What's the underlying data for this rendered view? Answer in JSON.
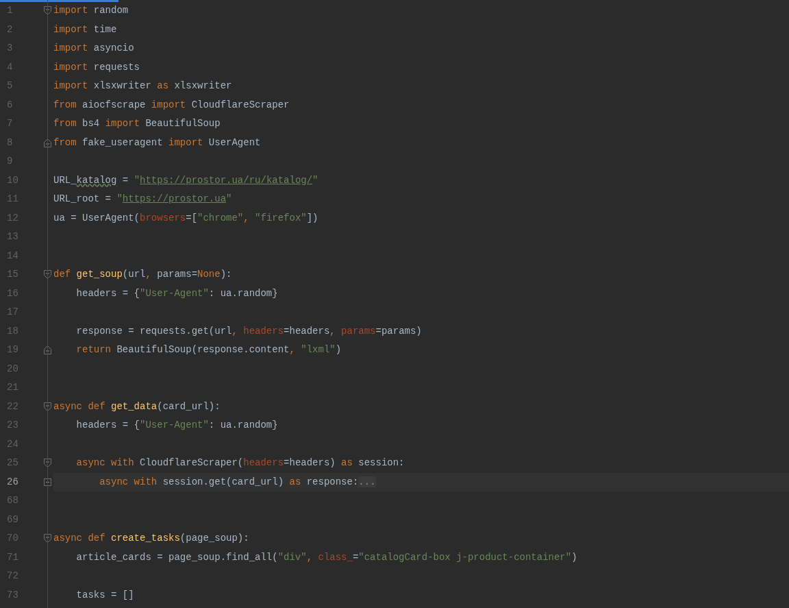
{
  "editor": {
    "lines": [
      {
        "number": "1",
        "fold": {
          "kind": "open"
        },
        "current": false,
        "tokens": [
          {
            "kind": "kw",
            "text": "import "
          },
          {
            "kind": "plain",
            "text": "random"
          }
        ]
      },
      {
        "number": "2",
        "current": false,
        "tokens": [
          {
            "kind": "kw",
            "text": "import "
          },
          {
            "kind": "plain",
            "text": "time"
          }
        ]
      },
      {
        "number": "3",
        "current": false,
        "tokens": [
          {
            "kind": "kw",
            "text": "import "
          },
          {
            "kind": "plain",
            "text": "asyncio"
          }
        ]
      },
      {
        "number": "4",
        "current": false,
        "tokens": [
          {
            "kind": "kw",
            "text": "import "
          },
          {
            "kind": "plain",
            "text": "requests"
          }
        ]
      },
      {
        "number": "5",
        "current": false,
        "tokens": [
          {
            "kind": "kw",
            "text": "import "
          },
          {
            "kind": "plain",
            "text": "xlsxwriter "
          },
          {
            "kind": "kw",
            "text": "as "
          },
          {
            "kind": "plain",
            "text": "xlsxwriter"
          }
        ]
      },
      {
        "number": "6",
        "current": false,
        "tokens": [
          {
            "kind": "kw",
            "text": "from "
          },
          {
            "kind": "plain",
            "text": "aiocfscrape "
          },
          {
            "kind": "kw",
            "text": "import "
          },
          {
            "kind": "plain",
            "text": "CloudflareScraper"
          }
        ]
      },
      {
        "number": "7",
        "current": false,
        "tokens": [
          {
            "kind": "kw",
            "text": "from "
          },
          {
            "kind": "plain",
            "text": "bs4 "
          },
          {
            "kind": "kw",
            "text": "import "
          },
          {
            "kind": "plain",
            "text": "BeautifulSoup"
          }
        ]
      },
      {
        "number": "8",
        "fold": {
          "kind": "close"
        },
        "current": false,
        "tokens": [
          {
            "kind": "kw",
            "text": "from "
          },
          {
            "kind": "plain",
            "text": "fake_useragent "
          },
          {
            "kind": "kw",
            "text": "import "
          },
          {
            "kind": "plain",
            "text": "UserAgent"
          }
        ]
      },
      {
        "number": "9",
        "current": false
      },
      {
        "number": "10",
        "current": false,
        "tokens": [
          {
            "kind": "plain",
            "text": "URL_"
          },
          {
            "kind": "typo",
            "text": "katalog"
          },
          {
            "kind": "plain",
            "text": " = "
          },
          {
            "kind": "str",
            "text": "\""
          },
          {
            "kind": "link",
            "text": "https://prostor.ua/ru/katalog/"
          },
          {
            "kind": "str",
            "text": "\""
          }
        ]
      },
      {
        "number": "11",
        "current": false,
        "tokens": [
          {
            "kind": "plain",
            "text": "URL_root = "
          },
          {
            "kind": "str",
            "text": "\""
          },
          {
            "kind": "link",
            "text": "https://prostor.ua"
          },
          {
            "kind": "str",
            "text": "\""
          }
        ]
      },
      {
        "number": "12",
        "current": false,
        "tokens": [
          {
            "kind": "plain",
            "text": "ua = UserAgent("
          },
          {
            "kind": "param",
            "text": "browsers"
          },
          {
            "kind": "plain",
            "text": "=["
          },
          {
            "kind": "str",
            "text": "\"chrome\""
          },
          {
            "kind": "kw",
            "text": ", "
          },
          {
            "kind": "str",
            "text": "\"firefox\""
          },
          {
            "kind": "plain",
            "text": "])"
          }
        ]
      },
      {
        "number": "13",
        "current": false
      },
      {
        "number": "14",
        "current": false
      },
      {
        "number": "15",
        "fold": {
          "kind": "open"
        },
        "current": false,
        "tokens": [
          {
            "kind": "kw",
            "text": "def "
          },
          {
            "kind": "fn",
            "text": "get_soup"
          },
          {
            "kind": "plain",
            "text": "(url"
          },
          {
            "kind": "kw",
            "text": ", "
          },
          {
            "kind": "plain",
            "text": "params="
          },
          {
            "kind": "kw",
            "text": "None"
          },
          {
            "kind": "plain",
            "text": "):"
          }
        ]
      },
      {
        "number": "16",
        "current": false,
        "tokens": [
          {
            "kind": "plain",
            "text": "    headers = {"
          },
          {
            "kind": "str",
            "text": "\"User-Agent\""
          },
          {
            "kind": "plain",
            "text": ": ua.random}"
          }
        ]
      },
      {
        "number": "17",
        "current": false
      },
      {
        "number": "18",
        "current": false,
        "tokens": [
          {
            "kind": "plain",
            "text": "    response = requests.get(url"
          },
          {
            "kind": "kw",
            "text": ", "
          },
          {
            "kind": "param",
            "text": "headers"
          },
          {
            "kind": "plain",
            "text": "=headers"
          },
          {
            "kind": "kw",
            "text": ", "
          },
          {
            "kind": "param",
            "text": "params"
          },
          {
            "kind": "plain",
            "text": "=params)"
          }
        ]
      },
      {
        "number": "19",
        "fold": {
          "kind": "close"
        },
        "current": false,
        "tokens": [
          {
            "kind": "kw",
            "text": "    return "
          },
          {
            "kind": "plain",
            "text": "BeautifulSoup(response.content"
          },
          {
            "kind": "kw",
            "text": ", "
          },
          {
            "kind": "str",
            "text": "\"lxml\""
          },
          {
            "kind": "plain",
            "text": ")"
          }
        ]
      },
      {
        "number": "20",
        "current": false
      },
      {
        "number": "21",
        "current": false
      },
      {
        "number": "22",
        "fold": {
          "kind": "open"
        },
        "current": false,
        "tokens": [
          {
            "kind": "kw",
            "text": "async def "
          },
          {
            "kind": "fn",
            "text": "get_data"
          },
          {
            "kind": "plain",
            "text": "(card_url):"
          }
        ]
      },
      {
        "number": "23",
        "current": false,
        "tokens": [
          {
            "kind": "plain",
            "text": "    headers = {"
          },
          {
            "kind": "str",
            "text": "\"User-Agent\""
          },
          {
            "kind": "plain",
            "text": ": ua.random}"
          }
        ]
      },
      {
        "number": "24",
        "current": false
      },
      {
        "number": "25",
        "fold": {
          "kind": "open"
        },
        "current": false,
        "tokens": [
          {
            "kind": "kw",
            "text": "    async with "
          },
          {
            "kind": "plain",
            "text": "CloudflareScraper("
          },
          {
            "kind": "param",
            "text": "headers"
          },
          {
            "kind": "plain",
            "text": "=headers) "
          },
          {
            "kind": "kw",
            "text": "as "
          },
          {
            "kind": "plain",
            "text": "session:"
          }
        ]
      },
      {
        "number": "26",
        "fold": {
          "kind": "collapsed"
        },
        "current": true,
        "tokens": [
          {
            "kind": "kw",
            "text": "        async with "
          },
          {
            "kind": "plain",
            "text": "session.get(card_url) "
          },
          {
            "kind": "kw",
            "text": "as "
          },
          {
            "kind": "plain",
            "text": "response:"
          },
          {
            "kind": "folded",
            "text": "..."
          }
        ]
      },
      {
        "number": "68",
        "current": false
      },
      {
        "number": "69",
        "current": false
      },
      {
        "number": "70",
        "fold": {
          "kind": "open"
        },
        "current": false,
        "tokens": [
          {
            "kind": "kw",
            "text": "async def "
          },
          {
            "kind": "fn",
            "text": "create_tasks"
          },
          {
            "kind": "plain",
            "text": "(page_soup):"
          }
        ]
      },
      {
        "number": "71",
        "current": false,
        "tokens": [
          {
            "kind": "plain",
            "text": "    article_cards = page_soup.find_all("
          },
          {
            "kind": "str",
            "text": "\"div\""
          },
          {
            "kind": "kw",
            "text": ", "
          },
          {
            "kind": "param",
            "text": "class_"
          },
          {
            "kind": "plain",
            "text": "="
          },
          {
            "kind": "str",
            "text": "\"catalogCard-box j-product-container\""
          },
          {
            "kind": "plain",
            "text": ")"
          }
        ]
      },
      {
        "number": "72",
        "current": false
      },
      {
        "number": "73",
        "current": false,
        "tokens": [
          {
            "kind": "plain",
            "text": "    tasks = []"
          }
        ]
      }
    ]
  }
}
